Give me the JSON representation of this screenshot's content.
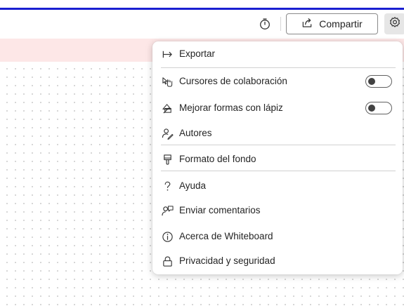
{
  "toolbar": {
    "share_label": "Compartir",
    "icons": {
      "timer": "timer-icon",
      "share": "share-icon",
      "settings": "gear-icon"
    },
    "accent_color": "#1a1fd1"
  },
  "menu": {
    "items": [
      {
        "label": "Exportar",
        "icon": "export-arrow-icon"
      },
      {
        "label": "Cursores de colaboración",
        "icon": "collaboration-cursors-icon",
        "toggle": false
      },
      {
        "label": "Mejorar formas con lápiz",
        "icon": "ink-shapes-icon",
        "toggle": false
      },
      {
        "label": "Autores",
        "icon": "authors-icon"
      },
      {
        "label": "Formato del fondo",
        "icon": "paint-brush-icon"
      },
      {
        "label": "Ayuda",
        "icon": "help-icon"
      },
      {
        "label": "Enviar comentarios",
        "icon": "feedback-icon"
      },
      {
        "label": "Acerca de Whiteboard",
        "icon": "info-icon"
      },
      {
        "label": "Privacidad y seguridad",
        "icon": "lock-icon"
      }
    ]
  }
}
